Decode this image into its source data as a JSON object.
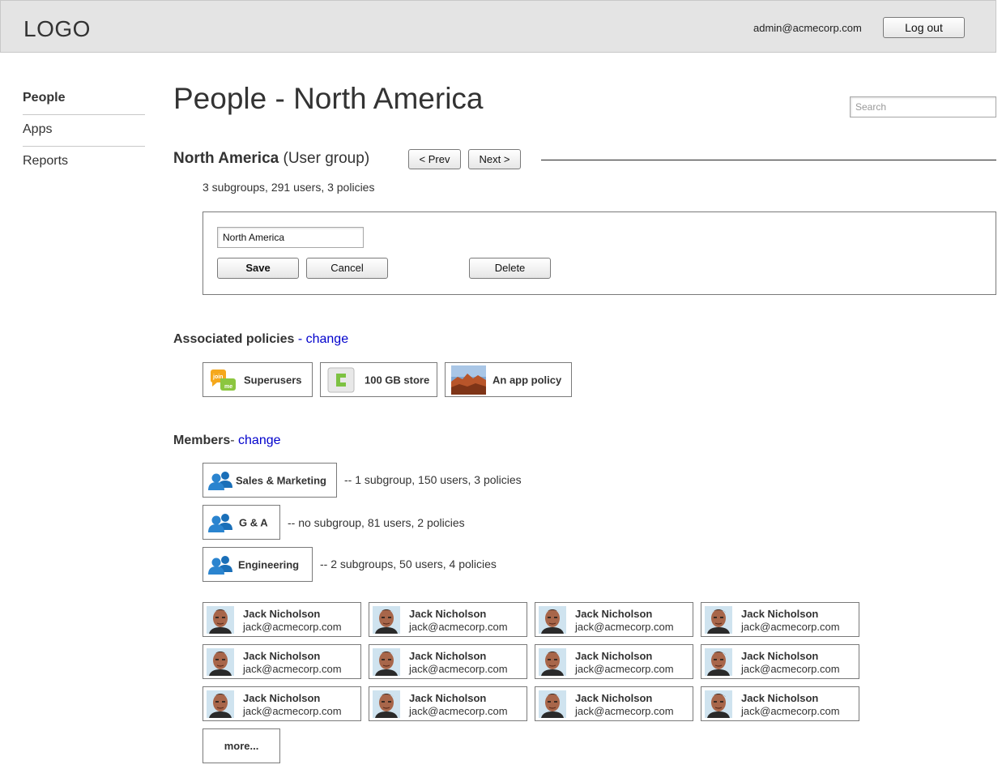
{
  "header": {
    "logo": "LOGO",
    "user_email": "admin@acmecorp.com",
    "logout_label": "Log out"
  },
  "sidenav": {
    "items": [
      {
        "label": "People",
        "active": true
      },
      {
        "label": "Apps",
        "active": false
      },
      {
        "label": "Reports",
        "active": false
      }
    ]
  },
  "page": {
    "title": "People - North America",
    "search_placeholder": "Search"
  },
  "group": {
    "name": "North America",
    "type_label": "(User group)",
    "prev_label": "< Prev",
    "next_label": "Next >",
    "summary": "3 subgroups, 291 users, 3 policies"
  },
  "edit_form": {
    "name_value": "North America",
    "save_label": "Save",
    "cancel_label": "Cancel",
    "delete_label": "Delete"
  },
  "policies": {
    "heading": "Associated policies",
    "change_prefix": " - ",
    "change_label": "change",
    "items": [
      {
        "label": "Superusers",
        "icon": "joinme-logo-icon"
      },
      {
        "label": "100 GB store",
        "icon": "storage-app-icon"
      },
      {
        "label": "An app policy",
        "icon": "landscape-photo-icon"
      }
    ]
  },
  "members": {
    "heading": "Members",
    "change_prefix": "- ",
    "change_label": "change",
    "groups": [
      {
        "label": "Sales & Marketing",
        "description": "-- 1 subgroup, 150 users, 3 policies",
        "icon": "user-group-icon"
      },
      {
        "label": "G & A",
        "description": "-- no subgroup, 81 users, 2 policies",
        "icon": "user-group-icon"
      },
      {
        "label": "Engineering",
        "description": "-- 2 subgroups, 50 users, 4 policies",
        "icon": "user-group-icon"
      }
    ],
    "users": [
      {
        "name": "Jack Nicholson",
        "email": "jack@acmecorp.com"
      },
      {
        "name": "Jack Nicholson",
        "email": "jack@acmecorp.com"
      },
      {
        "name": "Jack Nicholson",
        "email": "jack@acmecorp.com"
      },
      {
        "name": "Jack Nicholson",
        "email": "jack@acmecorp.com"
      },
      {
        "name": "Jack Nicholson",
        "email": "jack@acmecorp.com"
      },
      {
        "name": "Jack Nicholson",
        "email": "jack@acmecorp.com"
      },
      {
        "name": "Jack Nicholson",
        "email": "jack@acmecorp.com"
      },
      {
        "name": "Jack Nicholson",
        "email": "jack@acmecorp.com"
      },
      {
        "name": "Jack Nicholson",
        "email": "jack@acmecorp.com"
      },
      {
        "name": "Jack Nicholson",
        "email": "jack@acmecorp.com"
      },
      {
        "name": "Jack Nicholson",
        "email": "jack@acmecorp.com"
      },
      {
        "name": "Jack Nicholson",
        "email": "jack@acmecorp.com"
      }
    ],
    "more_label": "more..."
  },
  "colors": {
    "header_bg": "#e4e4e4",
    "link": "#0000cc",
    "border": "#7a7a7a"
  }
}
